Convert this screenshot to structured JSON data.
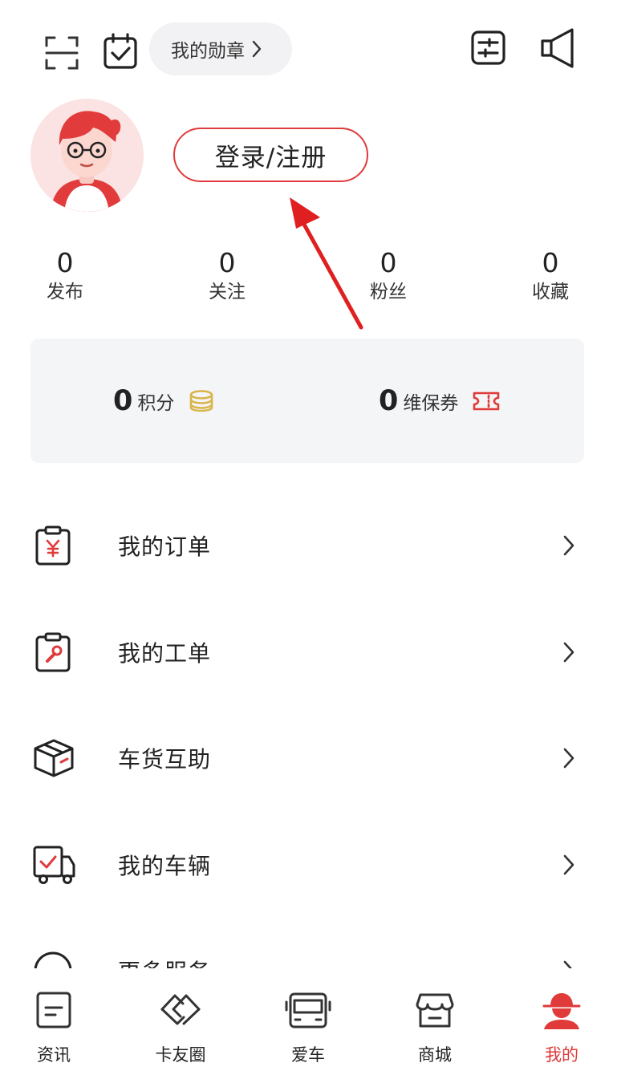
{
  "top_bar": {
    "scan_icon": "scan-icon",
    "calendar_icon": "calendar-check-icon",
    "medal_label": "我的勋章",
    "settings_icon": "sliders-icon",
    "speaker_icon": "speaker-icon"
  },
  "profile": {
    "login_label": "登录/注册"
  },
  "stats": [
    {
      "value": "0",
      "label": "发布"
    },
    {
      "value": "0",
      "label": "关注"
    },
    {
      "value": "0",
      "label": "粉丝"
    },
    {
      "value": "0",
      "label": "收藏"
    }
  ],
  "wallet": {
    "points_value": "0",
    "points_label": "积分",
    "coupon_value": "0",
    "coupon_label": "维保券"
  },
  "menu": [
    {
      "label": "我的订单",
      "icon": "order-clipboard-icon"
    },
    {
      "label": "我的工单",
      "icon": "work-order-icon"
    },
    {
      "label": "车货互助",
      "icon": "cargo-box-icon"
    },
    {
      "label": "我的车辆",
      "icon": "truck-icon"
    },
    {
      "label": "更多服务",
      "icon": "more-services-icon"
    }
  ],
  "bottom_nav": [
    {
      "label": "资讯",
      "icon": "news-icon"
    },
    {
      "label": "卡友圈",
      "icon": "handshake-icon"
    },
    {
      "label": "爱车",
      "icon": "bus-icon"
    },
    {
      "label": "商城",
      "icon": "store-icon"
    },
    {
      "label": "我的",
      "icon": "driver-icon",
      "active": true
    }
  ],
  "colors": {
    "accent": "#e03a3a",
    "card_bg": "#f4f5f7",
    "coin": "#d9b44a"
  }
}
